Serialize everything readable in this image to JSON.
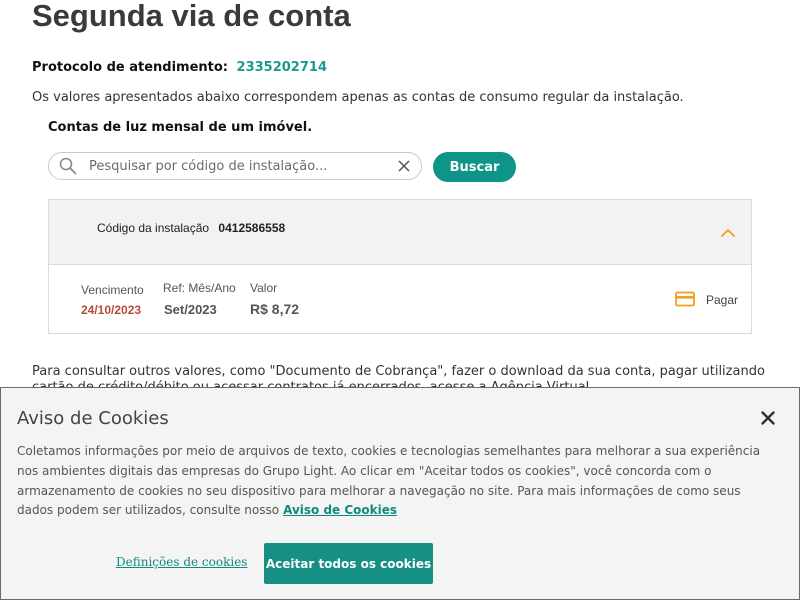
{
  "page": {
    "title": "Segunda via de conta",
    "protocol_label": "Protocolo de atendimento:",
    "protocol_number": "2335202714",
    "info_text": "Os valores apresentados abaixo correspondem apenas as contas de consumo regular da instalação.",
    "section_title": "Contas de luz mensal de um imóvel."
  },
  "search": {
    "placeholder": "Pesquisar por código de instalação...",
    "value": "",
    "button_label": "Buscar"
  },
  "bill": {
    "installation_label": "Código da instalação",
    "installation_code": "0412586558",
    "due_label": "Vencimento",
    "due_value": "24/10/2023",
    "ref_label": "Ref: Mês/Ano",
    "ref_value": "Set/2023",
    "amount_label": "Valor",
    "amount_value": "R$ 8,72",
    "pay_label": "Pagar"
  },
  "more_info": "Para consultar outros valores, como \"Documento de Cobrança\", fazer o download da sua conta, pagar utilizando cartão de crédito/débito ou acessar contratos já encerrados, acesse a Agência Virtual.",
  "cookies": {
    "title": "Aviso de Cookies",
    "text": "Coletamos informações por meio de arquivos de texto, cookies e tecnologias semelhantes para melhorar a sua experiência nos ambientes digitais das empresas do Grupo Light. Ao clicar em \"Aceitar todos os cookies\", você concorda com o armazenamento de cookies no seu dispositivo para melhorar a navegação no site. Para mais informações de como seus dados podem ser utilizados, consulte nosso",
    "link_label": "Aviso de Cookies",
    "settings_label": "Definições de cookies",
    "accept_label": "Aceitar todos os cookies"
  },
  "colors": {
    "accent": "#0f9488",
    "due_date": "#b84a3a",
    "icon_orange": "#f0a020"
  },
  "icons": {
    "search": "search-icon",
    "clear": "close-icon",
    "collapse": "chevron-up-icon",
    "payment": "credit-card-icon",
    "banner_close": "close-icon"
  }
}
